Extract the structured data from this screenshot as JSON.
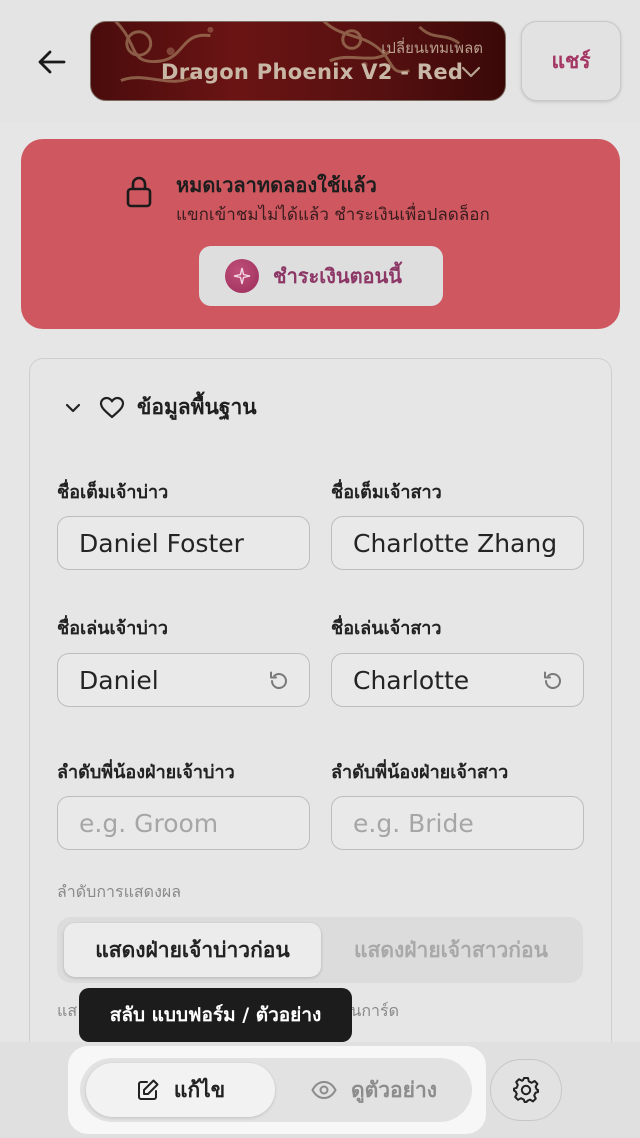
{
  "header": {
    "back_icon": "arrow-left-icon",
    "template_subtitle": "เปลี่ยนเทมเพลต",
    "template_name": "Dragon Phoenix V2 - Red",
    "share_label": "แชร์"
  },
  "trial_banner": {
    "title": "หมดเวลาทดลองใช้แล้ว",
    "subtitle": "แขกเข้าชมไม่ได้แล้ว ชำระเงินเพื่อปลดล็อก",
    "pay_label": "ชำระเงินตอนนี้",
    "color": "#cf5860"
  },
  "section": {
    "title": "ข้อมูลพื้นฐาน",
    "groom_fullname_label": "ชื่อเต็มเจ้าบ่าว",
    "groom_fullname_value": "Daniel Foster",
    "bride_fullname_label": "ชื่อเต็มเจ้าสาว",
    "bride_fullname_value": "Charlotte Zhang",
    "groom_nickname_label": "ชื่อเล่นเจ้าบ่าว",
    "groom_nickname_value": "Daniel",
    "bride_nickname_label": "ชื่อเล่นเจ้าสาว",
    "bride_nickname_value": "Charlotte",
    "groom_sibling_label": "ลำดับพี่น้องฝ่ายเจ้าบ่าว",
    "groom_sibling_placeholder": "e.g. Groom",
    "bride_sibling_label": "ลำดับพี่น้องฝ่ายเจ้าสาว",
    "bride_sibling_placeholder": "e.g. Bride",
    "display_order_label": "ลำดับการแสดงผล",
    "order_groom_first": "แสดงฝ่ายเจ้าบ่าวก่อน",
    "order_bride_first": "แสดงฝ่ายเจ้าสาวก่อน",
    "hint_start": "แส",
    "hint_end": "ดับแรกบนการ์ด"
  },
  "bottom": {
    "tooltip": "สลับ แบบฟอร์ม / ตัวอย่าง",
    "edit_label": "แก้ไข",
    "preview_label": "ดูตัวอย่าง",
    "active_mode": "แก้ไข"
  },
  "colors": {
    "accent": "#a43663",
    "background": "#e6e6e6"
  }
}
